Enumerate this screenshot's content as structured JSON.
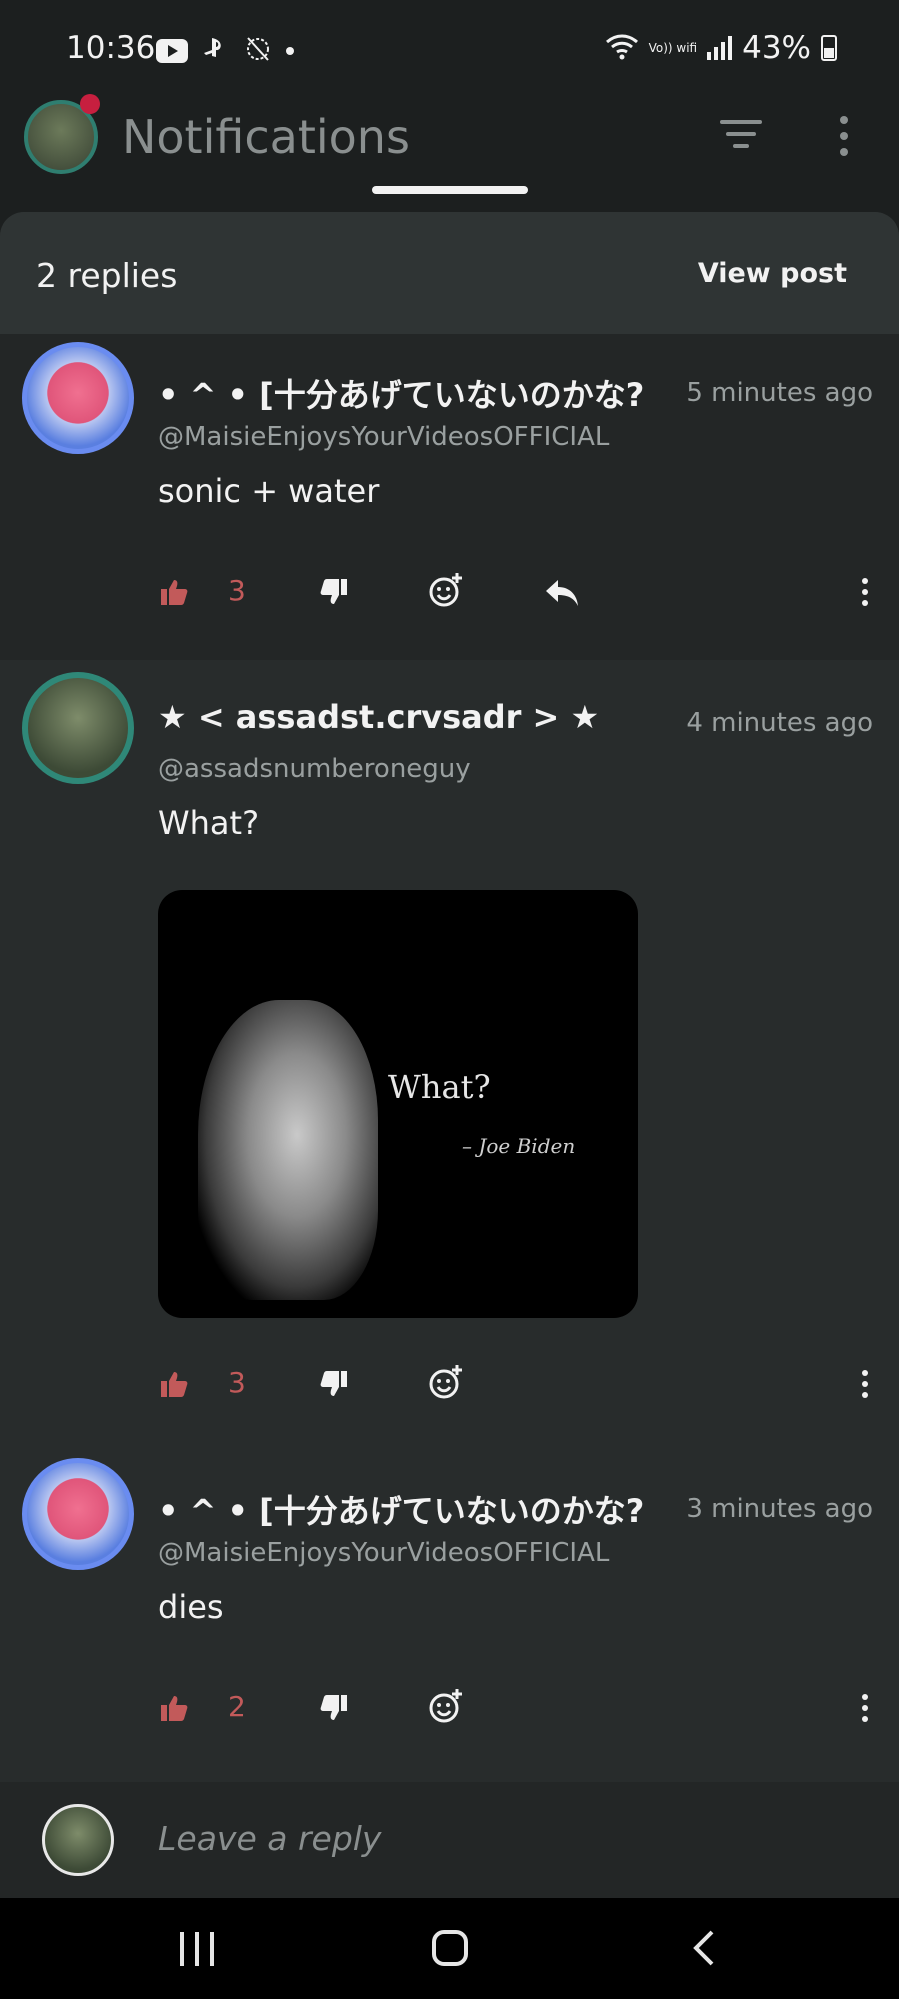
{
  "status_bar": {
    "time": "10:36",
    "battery": "43%",
    "icons": [
      "youtube-icon",
      "playstation-icon",
      "alarm-off-icon",
      "dot-icon",
      "wifi-icon",
      "volte-icon",
      "signal-icon",
      "battery-icon"
    ],
    "volte_label": "Vo)) wifi"
  },
  "header": {
    "title": "Notifications"
  },
  "sheet": {
    "title": "2 replies",
    "view_post": "View post"
  },
  "comments": [
    {
      "name": "• ^ • [十分あげていないのかな?",
      "handle": "@MaisieEnjoysYourVideosOFFICIAL",
      "time": "5 minutes ago",
      "body": "sonic + water",
      "likes": "3"
    },
    {
      "name": "★ < assadst.crvsadr > ★",
      "handle": "@assadsnumberoneguy",
      "time": "4 minutes ago",
      "body": "What?",
      "likes": "3",
      "image_text": "What?",
      "image_credit": "– Joe Biden"
    },
    {
      "name": "• ^ • [十分あげていないのかな?",
      "handle": "@MaisieEnjoysYourVideosOFFICIAL",
      "time": "3 minutes ago",
      "body": "dies",
      "likes": "2"
    }
  ],
  "reply_bar": {
    "placeholder": "Leave a reply"
  },
  "colors": {
    "background": "#1c1f1f",
    "sheet": "#282c2c",
    "like_active": "#c25a5a",
    "avatar_ring": "#2f8878"
  }
}
